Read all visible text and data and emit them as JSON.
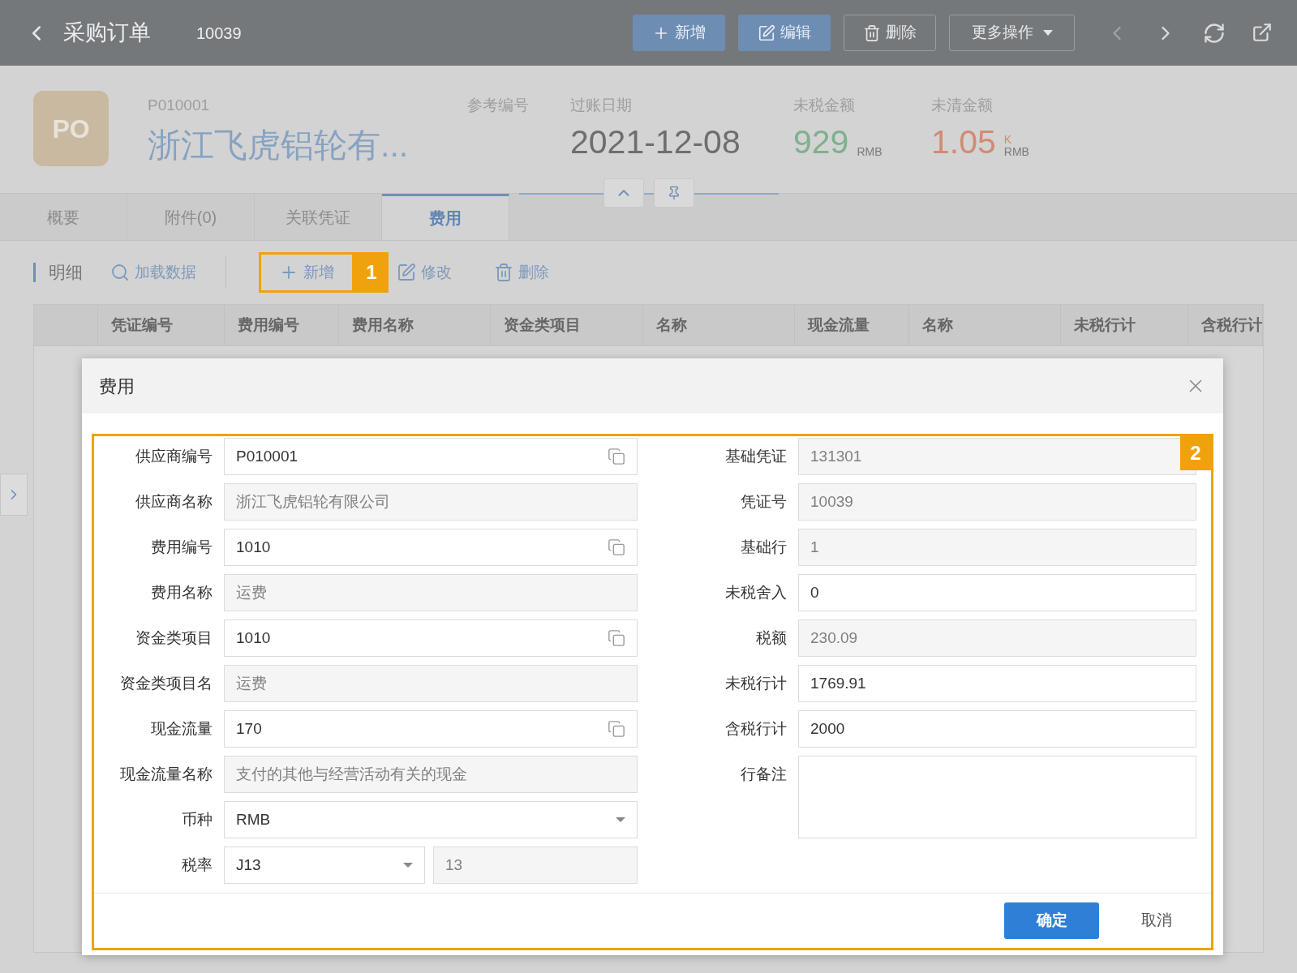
{
  "header": {
    "title": "采购订单",
    "doc_no": "10039",
    "buttons": [
      {
        "label": "新增",
        "kind": "primary"
      },
      {
        "label": "编辑",
        "kind": "primary"
      },
      {
        "label": "删除",
        "kind": "outline"
      },
      {
        "label": "更多操作",
        "kind": "outline"
      }
    ]
  },
  "summary": {
    "avatar": "PO",
    "code": "P010001",
    "name": "浙江飞虎铝轮有...",
    "fields": [
      {
        "label": "参考编号"
      },
      {
        "label": "过账日期",
        "value": "2021-12-08",
        "color": "#6e6e6e"
      },
      {
        "label": "未税金额",
        "value": "929",
        "unit": "RMB",
        "color": "#7fb08f"
      },
      {
        "label": "未清金额",
        "value": "1.05",
        "scale": "K",
        "unit": "RMB",
        "color": "#d18b74"
      }
    ]
  },
  "tabs": [
    {
      "label": "概要",
      "selected": false
    },
    {
      "label": "附件(0)",
      "selected": false
    },
    {
      "label": "关联凭证",
      "selected": false
    },
    {
      "label": "费用",
      "selected": true
    }
  ],
  "toolbar": {
    "section": "明细",
    "actions": [
      {
        "label": "加载数据",
        "kind": "search"
      },
      {
        "label": "新增",
        "kind": "add",
        "callout": "1"
      },
      {
        "label": "修改",
        "kind": "edit"
      },
      {
        "label": "删除",
        "kind": "delete"
      }
    ]
  },
  "table": {
    "columns": [
      "凭证编号",
      "费用编号",
      "费用名称",
      "资金类项目",
      "名称",
      "现金流量",
      "名称",
      "未税行计",
      "含税行计"
    ]
  },
  "dialog": {
    "title": "费用",
    "callout": "2",
    "left_fields": [
      {
        "label": "供应商编号",
        "kind": "lookup",
        "value": "P010001"
      },
      {
        "label": "供应商名称",
        "kind": "readonly",
        "value": "浙江飞虎铝轮有限公司"
      },
      {
        "label": "费用编号",
        "kind": "lookup",
        "value": "1010"
      },
      {
        "label": "费用名称",
        "kind": "readonly",
        "value": "运费"
      },
      {
        "label": "资金类项目",
        "kind": "lookup",
        "value": "1010"
      },
      {
        "label": "资金类项目名",
        "kind": "readonly",
        "value": "运费"
      },
      {
        "label": "现金流量",
        "kind": "lookup",
        "value": "170"
      },
      {
        "label": "现金流量名称",
        "kind": "readonly",
        "value": "支付的其他与经营活动有关的现金"
      },
      {
        "label": "币种",
        "kind": "select",
        "value": "RMB"
      },
      {
        "label": "税率",
        "kind": "select_pair",
        "value": "J13",
        "extra": "13"
      }
    ],
    "right_fields": [
      {
        "label": "基础凭证",
        "kind": "readonly",
        "value": "131301"
      },
      {
        "label": "凭证号",
        "kind": "readonly",
        "value": "10039"
      },
      {
        "label": "基础行",
        "kind": "readonly",
        "value": "1"
      },
      {
        "label": "未税舍入",
        "kind": "input",
        "value": "0"
      },
      {
        "label": "税额",
        "kind": "readonly",
        "value": "230.09"
      },
      {
        "label": "未税行计",
        "kind": "input",
        "value": "1769.91"
      },
      {
        "label": "含税行计",
        "kind": "input",
        "value": "2000"
      },
      {
        "label": "行备注",
        "kind": "textarea"
      }
    ],
    "buttons": [
      {
        "label": "确定",
        "kind": "primary"
      },
      {
        "label": "取消",
        "kind": "text"
      }
    ]
  }
}
